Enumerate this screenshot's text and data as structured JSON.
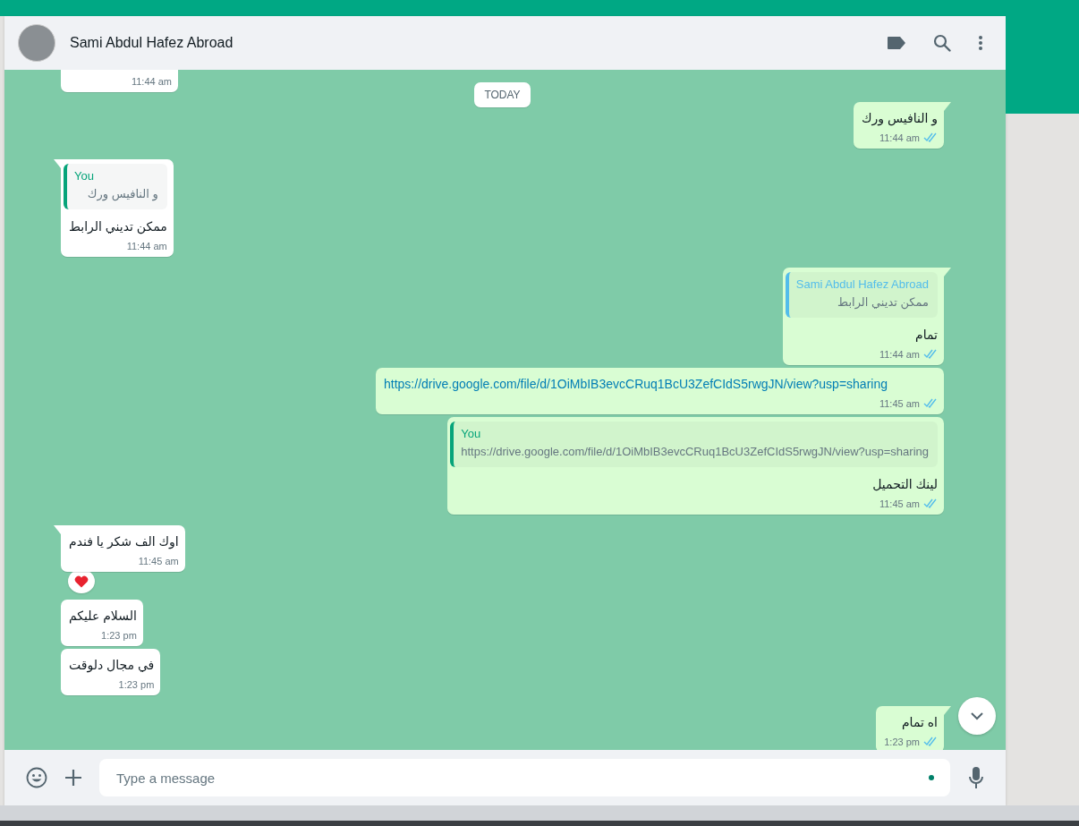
{
  "chat_header": {
    "contact_name": "Sami Abdul Hafez Abroad"
  },
  "messages": [
    {
      "kind": "text",
      "outgoing": false,
      "tail": false,
      "time": "11:44 am",
      "cut_top": true
    },
    {
      "kind": "date",
      "label": "TODAY"
    },
    {
      "kind": "text",
      "outgoing": true,
      "tail": true,
      "text": "و النافيس ورك",
      "time": "11:44 am",
      "read": true
    },
    {
      "kind": "text",
      "outgoing": false,
      "tail": true,
      "quote": {
        "author": "You",
        "color": "#06a47a",
        "text": "و النافيس ورك"
      },
      "text": "ممكن تديني الرابط",
      "time": "11:44 am"
    },
    {
      "kind": "text",
      "outgoing": true,
      "tail": true,
      "quote": {
        "author": "Sami Abdul Hafez Abroad",
        "color": "#53bdeb",
        "text": "ممكن تديني الرابط"
      },
      "text": "تمام",
      "time": "11:44 am",
      "read": true
    },
    {
      "kind": "link",
      "outgoing": true,
      "tail": false,
      "text": "https://drive.google.com/file/d/1OiMbIB3evcCRuq1BcU3ZefCIdS5rwgJN/view?usp=sharing",
      "time": "11:45 am",
      "read": true
    },
    {
      "kind": "text",
      "outgoing": true,
      "tail": false,
      "quote": {
        "author": "You",
        "color": "#06a47a",
        "text": "https://drive.google.com/file/d/1OiMbIB3evcCRuq1BcU3ZefCIdS5rwgJN/view?usp=sharing"
      },
      "text": "لينك التحميل",
      "time": "11:45 am",
      "read": true
    },
    {
      "kind": "text",
      "outgoing": false,
      "tail": true,
      "text": "اوك الف شكر يا فندم",
      "time": "11:45 am",
      "reaction": true
    },
    {
      "kind": "text",
      "outgoing": false,
      "tail": false,
      "text": "السلام عليكم",
      "time": "1:23 pm"
    },
    {
      "kind": "text",
      "outgoing": false,
      "tail": false,
      "text": "في مجال دلوقت",
      "time": "1:23 pm"
    },
    {
      "kind": "text",
      "outgoing": true,
      "tail": true,
      "text": "اه تمام",
      "time": "1:23 pm",
      "read": true
    }
  ],
  "composer": {
    "placeholder": "Type a message"
  }
}
